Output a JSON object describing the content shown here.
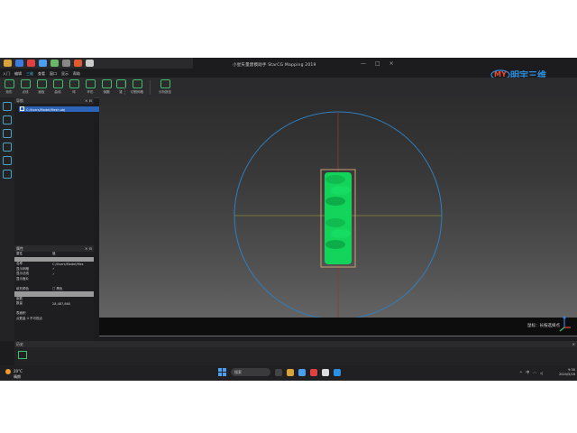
{
  "window": {
    "title": "小星矢量建模助手 StarCG Mapping 2019",
    "controls": [
      "—",
      "□",
      "×"
    ]
  },
  "logo": {
    "mark": "MY",
    "text": "明宇三维"
  },
  "menubar": {
    "items": [
      "入门",
      "编辑",
      "三维",
      "查看",
      "窗口",
      "显示",
      "帮助"
    ],
    "active_index": 2
  },
  "ribbon": {
    "tools": [
      "矩形",
      "点线",
      "面板",
      "曲线",
      "球",
      "环形",
      "倒圆",
      "锥",
      "体",
      "平面",
      "切割网格",
      "分析报告"
    ]
  },
  "navigator": {
    "title": "导航",
    "tree_item": "C:/Users/Model/Mesh.obj"
  },
  "properties": {
    "title": "属性",
    "rows": [
      {
        "key": "属性",
        "value": "值"
      },
      {
        "key": "",
        "value": ""
      },
      {
        "key": "名称",
        "value": "C:/Users/Model/Mes"
      },
      {
        "key": "显示网格",
        "value": "✓"
      },
      {
        "key": "显示法线",
        "value": "✓"
      },
      {
        "key": "显示面片",
        "value": ""
      },
      {
        "key": "",
        "value": ""
      },
      {
        "key": "填充颜色",
        "value": "□ 黑色"
      },
      {
        "key": "",
        "value": ""
      },
      {
        "key": "面数",
        "value": ""
      },
      {
        "key": "数量",
        "value": "28,487,860"
      },
      {
        "key": "",
        "value": ""
      },
      {
        "key": "表面积",
        "value": ""
      },
      {
        "key": "点数量 4 不可视点",
        "value": ""
      }
    ]
  },
  "viewport": {
    "hint": "鼠标：长按选择点"
  },
  "bottom_panel": {
    "title": "历史"
  },
  "taskbar": {
    "weather": {
      "temp": "20°C",
      "desc": "晴朗"
    },
    "search_placeholder": "搜索",
    "clock_time": "9:30",
    "clock_date": "2024/5/16",
    "colors": {
      "accent": "#4aa0f0",
      "model_green": "#12d45a",
      "orbit_blue": "#2f7fc0"
    }
  }
}
